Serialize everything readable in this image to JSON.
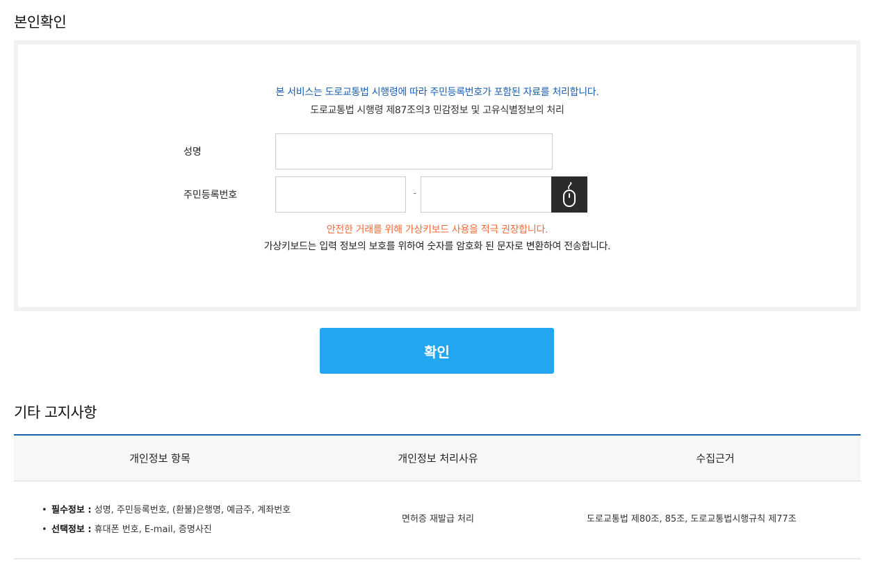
{
  "verification": {
    "title": "본인확인",
    "notice_blue": "본 서비스는 도로교통법 시행령에 따라 주민등록번호가 포함된 자료를 처리합니다.",
    "notice_sub": "도로교통법 시행령 제87조의3 민감정보 및 고유식별정보의 처리",
    "name_label": "성명",
    "name_value": "",
    "rrn_label": "주민등록번호",
    "rrn_front_value": "",
    "rrn_separator": "-",
    "rrn_back_value": "",
    "keypad_icon": "mouse-icon",
    "notice_orange": "안전한 거래를 위해 가상키보드 사용을 적극 권장합니다.",
    "notice_dark": "가상키보드는 입력 정보의 보호를 위하여 숫자를 암호화 된 문자로 변환하여 전송합니다.",
    "confirm_label": "확인"
  },
  "other_notice": {
    "title": "기타 고지사항",
    "headers": [
      "개인정보 항목",
      "개인정보 처리사유",
      "수집근거"
    ],
    "required_label": "필수정보 :",
    "required_text": " 성명, 주민등록번호, (환불)은행명, 예금주, 계좌번호",
    "optional_label": "선택정보 :",
    "optional_text": " 휴대폰 번호, E-mail, 증명사진",
    "reason": "면허증 재발급 처리",
    "basis": "도로교통법 제80조, 85조, 도로교통법시행규칙 제77조"
  },
  "colors": {
    "accent_blue": "#1a5fb4",
    "button_blue": "#23a6f0",
    "warning_orange": "#f26b3a",
    "keypad_dark": "#2b2b2b"
  }
}
